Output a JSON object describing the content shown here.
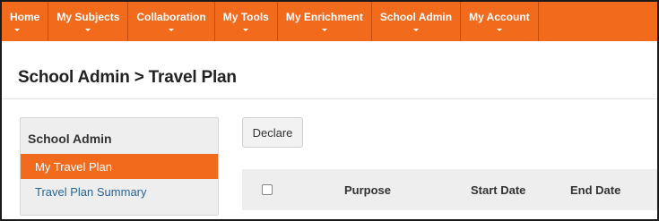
{
  "nav": {
    "items": [
      {
        "label": "Home"
      },
      {
        "label": "My Subjects"
      },
      {
        "label": "Collaboration"
      },
      {
        "label": "My Tools"
      },
      {
        "label": "My Enrichment"
      },
      {
        "label": "School Admin"
      },
      {
        "label": "My Account"
      }
    ]
  },
  "page": {
    "heading": "School Admin > Travel Plan"
  },
  "sidebar": {
    "title": "School Admin",
    "items": [
      {
        "label": "My Travel Plan",
        "active": true
      },
      {
        "label": "Travel Plan Summary",
        "active": false
      }
    ]
  },
  "toolbar": {
    "declare_label": "Declare"
  },
  "table": {
    "columns": [
      "",
      "Purpose",
      "Start Date",
      "End Date"
    ]
  },
  "colors": {
    "accent": "#f26b1d",
    "link": "#2a6496",
    "panel": "#eeeeee"
  }
}
